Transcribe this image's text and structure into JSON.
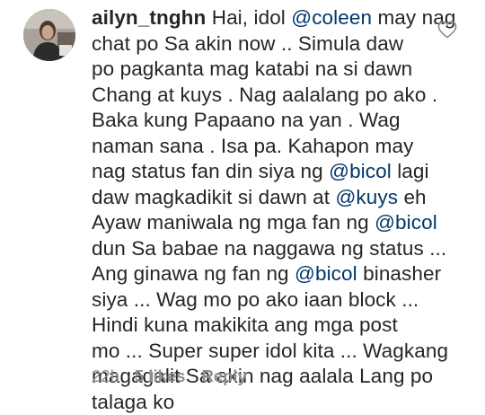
{
  "comment": {
    "username": "ailyn_tnghn",
    "lines": [
      [
        {
          "t": "Hai, idol "
        },
        {
          "t": "@coleen",
          "m": true
        },
        {
          "t": " may nag"
        }
      ],
      [
        {
          "t": "chat po Sa akin now .. Simula daw"
        }
      ],
      [
        {
          "t": "po pagkanta mag katabi na si dawn"
        }
      ],
      [
        {
          "t": "Chang at kuys . Nag aalalang po ako ."
        }
      ],
      [
        {
          "t": "Baka kung Papaano na yan . Wag"
        }
      ],
      [
        {
          "t": "naman sana . Isa pa. Kahapon may"
        }
      ],
      [
        {
          "t": "nag status fan din siya ng "
        },
        {
          "t": "@bicol",
          "m": true
        },
        {
          "t": " lagi"
        }
      ],
      [
        {
          "t": "daw magkadikit si dawn at "
        },
        {
          "t": "@kuys",
          "m": true
        },
        {
          "t": " eh"
        }
      ],
      [
        {
          "t": "Ayaw maniwala ng mga fan ng "
        },
        {
          "t": "@bicol",
          "m": true
        }
      ],
      [
        {
          "t": "dun Sa babae na naggawa ng status ..."
        }
      ],
      [
        {
          "t": "Ang ginawa ng fan ng "
        },
        {
          "t": "@bicol",
          "m": true
        },
        {
          "t": " binasher"
        }
      ],
      [
        {
          "t": "siya ... Wag mo po ako iaan block ..."
        }
      ],
      [
        {
          "t": "Hindi kuna makikita ang mga post"
        }
      ],
      [
        {
          "t": "mo ... Super super idol kita ... Wagkang"
        }
      ],
      [
        {
          "t": "magagalit Sa akin nag aalala Lang po"
        }
      ],
      [
        {
          "t": "talaga ko"
        }
      ]
    ],
    "time": "22h",
    "likes": "5 likes",
    "reply": "Reply",
    "like_icon": "heart-outline-icon"
  },
  "colors": {
    "text": "#262626",
    "mention": "#00376b",
    "meta": "#8e8e8e"
  }
}
